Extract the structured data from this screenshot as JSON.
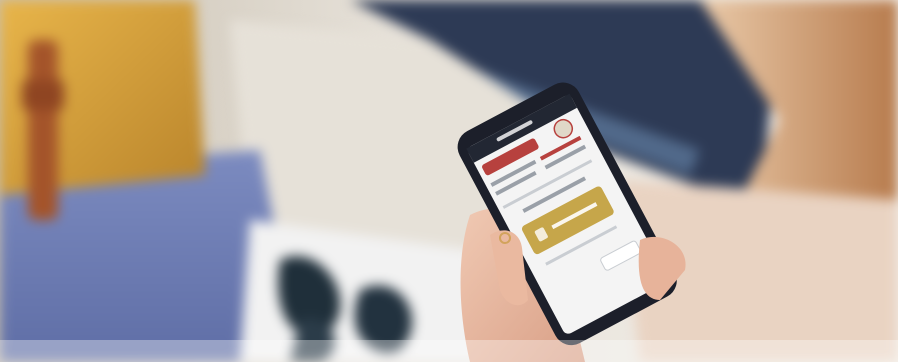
{
  "scene": {
    "subject": "person-holding-smartphone",
    "colors": {
      "backpack": "#d9a13a",
      "strap": "#a4542a",
      "seat": "#6f7fb5",
      "window": "#2d3a55",
      "skin": "#e9b9a0",
      "hair": "#c98a5a",
      "phone_frame": "#1c1f2a",
      "app_header": "#222733",
      "app_red": "#b7413e",
      "app_gold": "#c6a64a"
    }
  }
}
